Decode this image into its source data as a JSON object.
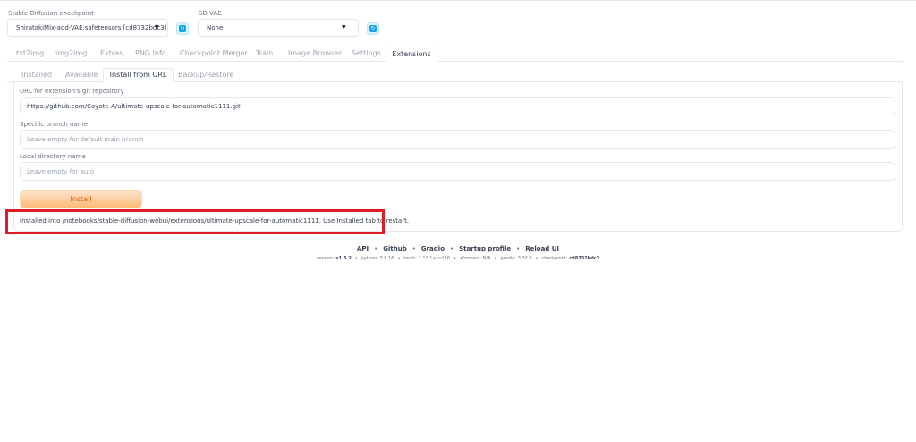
{
  "header": {
    "checkpoint_label": "Stable Diffusion checkpoint",
    "checkpoint_value": "ShiratakiMix-add-VAE.safetensors [cd8732bdc3]",
    "vae_label": "SD VAE",
    "vae_value": "None"
  },
  "tabs": [
    "txt2img",
    "img2img",
    "Extras",
    "PNG Info",
    "Checkpoint Merger",
    "Train",
    "Image Browser",
    "Settings",
    "Extensions"
  ],
  "active_tab": "Extensions",
  "subtabs": [
    "Installed",
    "Available",
    "Install from URL",
    "Backup/Restore"
  ],
  "active_subtab": "Install from URL",
  "form": {
    "url_label": "URL for extension's git repository",
    "url_value": "https://github.com/Coyote-A/ultimate-upscale-for-automatic1111.git",
    "branch_label": "Specific branch name",
    "branch_placeholder": "Leave empty for default main branch",
    "dir_label": "Local directory name",
    "dir_placeholder": "Leave empty for auto",
    "install_label": "Install",
    "result_message": "Installed into /notebooks/stable-diffusion-webui/extensions/ultimate-upscale-for-automatic1111. Use Installed tab to restart."
  },
  "footer": {
    "links": [
      "API",
      "Github",
      "Gradio",
      "Startup profile",
      "Reload UI"
    ],
    "version_label": "version:",
    "version_value": "v1.5.2",
    "python": "python: 3.9.16",
    "torch": "torch: 1.12.1+cu116",
    "xformers": "xformers: N/A",
    "gradio": "gradio: 3.32.0",
    "checkpoint_label": "checkpoint:",
    "checkpoint_value": "cd8732bdc3"
  },
  "colors": {
    "accent_orange": "#ea580c",
    "highlight_red": "#e11d24",
    "refresh_blue": "#0ea5e9"
  },
  "icons": {
    "refresh": "refresh-icon",
    "dropdown": "chevron-down-icon"
  }
}
